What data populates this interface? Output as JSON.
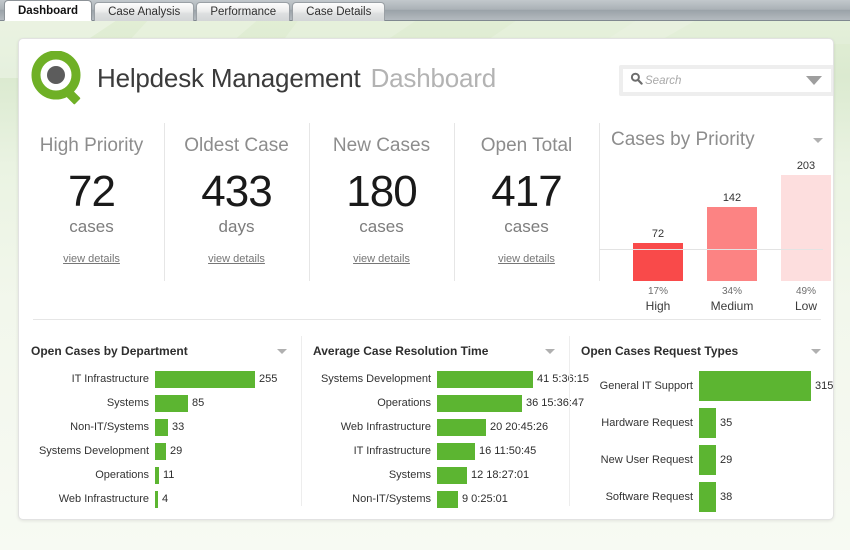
{
  "tabs": [
    {
      "label": "Dashboard",
      "active": true
    },
    {
      "label": "Case Analysis",
      "active": false
    },
    {
      "label": "Performance",
      "active": false
    },
    {
      "label": "Case Details",
      "active": false
    }
  ],
  "header": {
    "logo_name": "magnifier-logo",
    "title_main": "Helpdesk Management",
    "title_sub": "Dashboard"
  },
  "search": {
    "placeholder": "Search",
    "value": "",
    "icon": "search-icon",
    "caret": "chevron-down-icon"
  },
  "kpis": [
    {
      "label": "High Priority",
      "value": "72",
      "unit": "cases",
      "link": "view details"
    },
    {
      "label": "Oldest Case",
      "value": "433",
      "unit": "days",
      "link": "view details"
    },
    {
      "label": "New Cases",
      "value": "180",
      "unit": "cases",
      "link": "view details"
    },
    {
      "label": "Open Total",
      "value": "417",
      "unit": "cases",
      "link": "view details"
    }
  ],
  "colors": {
    "green_bar": "#5cb531",
    "priority_high": "#f94a4a",
    "priority_medium": "#fc8383",
    "priority_low": "#fddede",
    "accent_logo": "#6fb026"
  },
  "chart_data": [
    {
      "type": "bar",
      "title": "Cases by Priority",
      "categories": [
        "High",
        "Medium",
        "Low"
      ],
      "values": [
        72,
        142,
        203
      ],
      "percents": [
        "17%",
        "34%",
        "49%"
      ],
      "colors": [
        "#f94a4a",
        "#fc8383",
        "#fddede"
      ],
      "xlabel": "",
      "ylabel": "",
      "ylim": [
        0,
        215
      ],
      "grid": false,
      "legend": "none",
      "orientation": "vertical"
    },
    {
      "type": "bar",
      "title": "Open Cases by Department",
      "orientation": "horizontal",
      "categories": [
        "IT Infrastructure",
        "Systems",
        "Non-IT/Systems",
        "Systems Development",
        "Operations",
        "Web Infrastructure"
      ],
      "values": [
        255,
        85,
        33,
        29,
        11,
        4
      ],
      "value_labels": [
        "255",
        "85",
        "33",
        "29",
        "11",
        "4"
      ],
      "color": "#5cb531",
      "xlabel": "",
      "ylabel": "",
      "grid": false,
      "legend": "none",
      "xlim": [
        0,
        255
      ]
    },
    {
      "type": "bar",
      "title": "Average Case Resolution Time",
      "orientation": "horizontal",
      "categories": [
        "Systems Development",
        "Operations",
        "Web Infrastructure",
        "IT Infrastructure",
        "Systems",
        "Non-IT/Systems"
      ],
      "values": [
        41.23,
        36.65,
        20.86,
        16.49,
        12.77,
        9.02
      ],
      "value_labels": [
        "41 5:36:15",
        "36 15:36:47",
        "20 20:45:26",
        "16 11:50:45",
        "12 18:27:01",
        "9 0:25:01"
      ],
      "color": "#5cb531",
      "xlabel": "",
      "ylabel": "",
      "grid": false,
      "legend": "none",
      "xlim": [
        0,
        41.23
      ]
    },
    {
      "type": "bar",
      "title": "Open Cases Request Types",
      "orientation": "horizontal",
      "categories": [
        "General IT Support",
        "Hardware Request",
        "New User Request",
        "Software Request"
      ],
      "values": [
        315,
        35,
        29,
        38
      ],
      "value_labels": [
        "315",
        "35",
        "29",
        "38"
      ],
      "color": "#5cb531",
      "xlabel": "",
      "ylabel": "",
      "grid": false,
      "legend": "none",
      "xlim": [
        0,
        315
      ]
    }
  ]
}
